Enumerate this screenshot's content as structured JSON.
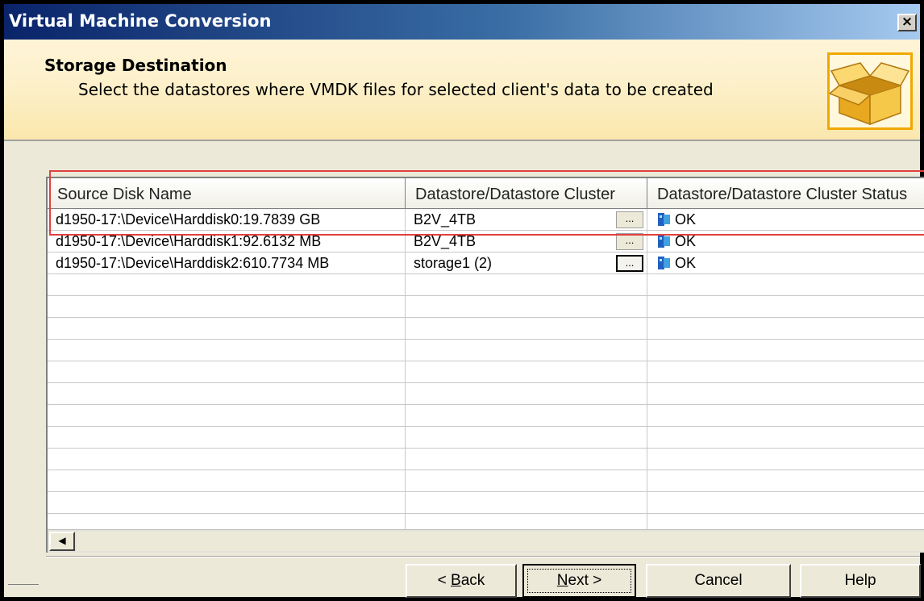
{
  "window": {
    "title": "Virtual Machine Conversion",
    "close_label": "×"
  },
  "header": {
    "title": "Storage Destination",
    "subtitle": "Select the datastores where VMDK files for selected client's data to be created",
    "icon": "open-box-icon"
  },
  "table": {
    "columns": [
      "Source Disk Name",
      "Datastore/Datastore Cluster",
      "Datastore/Datastore Cluster Status"
    ],
    "rows": [
      {
        "source": "d1950-17:\\Device\\Harddisk0:19.7839 GB",
        "datastore": "B2V_4TB",
        "status": "OK"
      },
      {
        "source": "d1950-17:\\Device\\Harddisk1:92.6132 MB",
        "datastore": "B2V_4TB",
        "status": "OK"
      },
      {
        "source": "d1950-17:\\Device\\Harddisk2:610.7734 MB",
        "datastore": "storage1 (2)",
        "status": "OK"
      }
    ],
    "ellipsis_label": "...",
    "highlight_color": "#e04040"
  },
  "scrollbar": {
    "left_arrow": "◀"
  },
  "buttons": {
    "back": {
      "prefix": "< ",
      "mnemonic": "B",
      "rest": "ack"
    },
    "next": {
      "mnemonic": "N",
      "rest": "ext >"
    },
    "cancel": "Cancel",
    "help": "Help"
  },
  "colors": {
    "title_gradient_start": "#0a246a",
    "header_bg": "#fdf1cc",
    "dialog_bg": "#ece9d8"
  }
}
